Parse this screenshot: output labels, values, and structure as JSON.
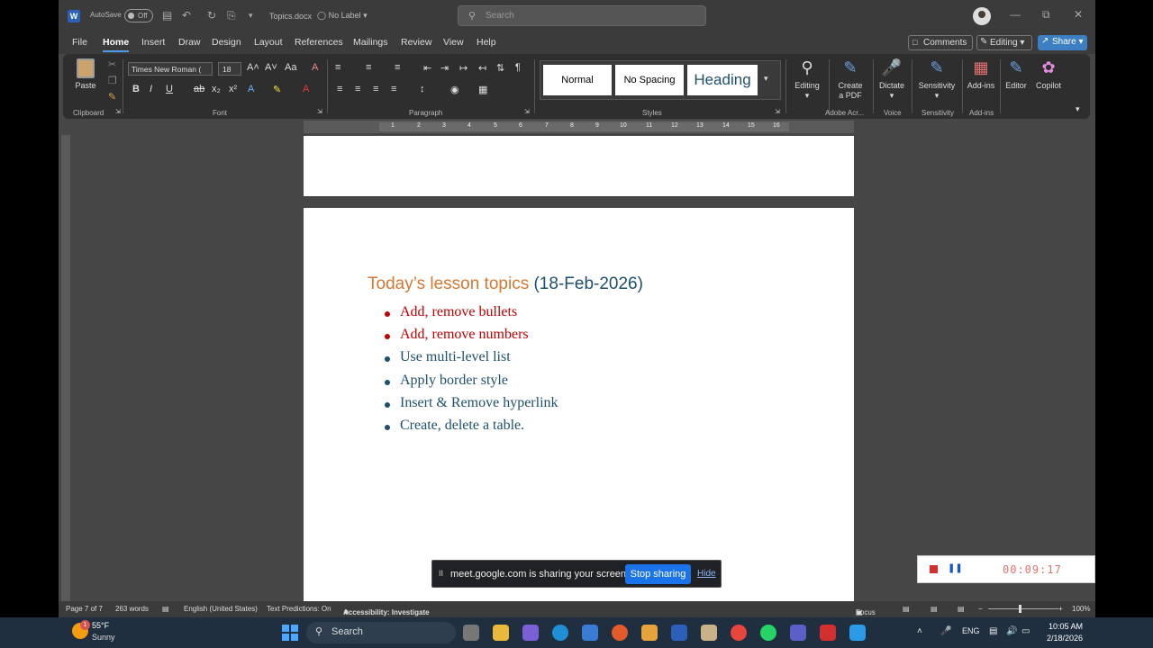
{
  "titlebar": {
    "autosave_label": "AutoSave",
    "autosave_state": "Off",
    "doc_name": "Topics.docx",
    "sensitivity_label": "No Label",
    "search_placeholder": "Search"
  },
  "tabs": [
    "File",
    "Home",
    "Insert",
    "Draw",
    "Design",
    "Layout",
    "References",
    "Mailings",
    "Review",
    "View",
    "Help"
  ],
  "active_tab": "Home",
  "tab_actions": {
    "comments": "Comments",
    "editing": "Editing",
    "share": "Share"
  },
  "ribbon": {
    "paste_label": "Paste",
    "font_name": "Times New Roman (",
    "font_size": "18",
    "groups": {
      "clipboard": "Clipboard",
      "font": "Font",
      "paragraph": "Paragraph",
      "styles": "Styles",
      "adobe": "Adobe Acr...",
      "voice": "Voice",
      "sensitivity": "Sensitivity",
      "addins": "Add-ins"
    },
    "styles": [
      "Normal",
      "No Spacing",
      "Heading"
    ],
    "buttons": {
      "editing": "Editing",
      "create_pdf_1": "Create",
      "create_pdf_2": "a PDF",
      "dictate": "Dictate",
      "sensitivity": "Sensitivity",
      "addins": "Add-ins",
      "editor": "Editor",
      "copilot": "Copilot"
    }
  },
  "ruler_numbers": [
    "1",
    "2",
    "3",
    "4",
    "5",
    "6",
    "7",
    "8",
    "9",
    "10",
    "11",
    "12",
    "13",
    "14",
    "15",
    "16"
  ],
  "document": {
    "heading_part1": "Today’s lesson topics",
    "heading_part2": "(18-Feb-2026)",
    "items": [
      {
        "text": "Add, remove bullets",
        "color": "#c00000"
      },
      {
        "text": "Add, remove numbers",
        "color": "#c00000"
      },
      {
        "text": "Use multi-level list",
        "color": "#1e4f6b"
      },
      {
        "text": "Apply border style",
        "color": "#1e4f6b"
      },
      {
        "text": "Insert & Remove hyperlink",
        "color": "#1e4f6b"
      },
      {
        "text": "Create, delete a table.",
        "color": "#1e4f6b"
      }
    ],
    "heading_color_1": "#d47833",
    "heading_color_2": "#1e4f6b"
  },
  "share_banner": {
    "pause_icon": "II",
    "message": "meet.google.com is sharing your screen.",
    "stop_label": "Stop sharing",
    "hide_label": "Hide"
  },
  "recorder": {
    "time": "00:09:17"
  },
  "statusbar": {
    "page": "Page 7 of 7",
    "words": "263 words",
    "language": "English (United States)",
    "text_predictions": "Text Predictions: On",
    "accessibility": "Accessibility: Investigate",
    "focus": "Focus",
    "zoom": "100%"
  },
  "taskbar": {
    "weather_badge": "1",
    "temperature": "55°F",
    "condition": "Sunny",
    "search_label": "Search",
    "language": "ENG",
    "time": "10:05 AM",
    "date": "2/18/2026"
  }
}
